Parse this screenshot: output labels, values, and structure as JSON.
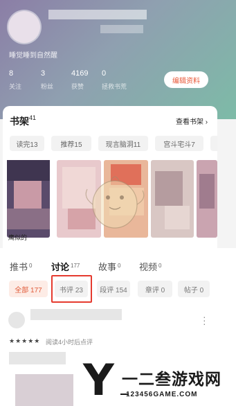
{
  "profile": {
    "motto": "睡觉睡到自然醒",
    "edit_label": "编辑资料",
    "stats": [
      {
        "value": "8",
        "label": "关注"
      },
      {
        "value": "3",
        "label": "粉丝"
      },
      {
        "value": "4169",
        "label": "获赞"
      },
      {
        "value": "0",
        "label": "拯救书荒"
      }
    ],
    "colors": {
      "accent": "#e95a3b",
      "header_start": "#8b7ea6",
      "header_end": "#7dbba7"
    }
  },
  "bookshelf": {
    "title": "书架",
    "count": "41",
    "view_link": "查看书架 ›",
    "chips": [
      "读完13",
      "推荐15",
      "现言脑洞11",
      "宫斗宅斗7"
    ],
    "first_cover_title": "鹰似的"
  },
  "discuss": {
    "tabs": [
      {
        "label": "推书",
        "count": "0"
      },
      {
        "label": "讨论",
        "count": "177"
      },
      {
        "label": "故事",
        "count": "0"
      },
      {
        "label": "视频",
        "count": "0"
      }
    ],
    "active_tab": "讨论",
    "filters": [
      "全部 177",
      "书评 23",
      "段评 154",
      "章评 0",
      "帖子 0"
    ],
    "active_filter": "全部 177",
    "highlight_color": "#e53a2e"
  },
  "post": {
    "stars": "★★★★★",
    "note": "阅读4小时后点评",
    "more_icon": "more-vertical-icon"
  },
  "watermark": {
    "letter": "Y",
    "text": "一二叁游戏网",
    "url": "123456GAME.COM"
  }
}
